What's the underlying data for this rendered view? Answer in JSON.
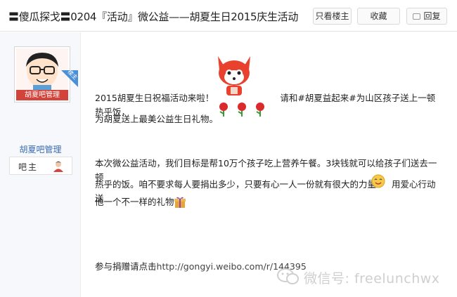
{
  "header": {
    "title": "〓傻瓜探戈〓0204『活动』微公益——胡夏生日2015庆生活动",
    "only_author_label": "只看楼主",
    "collect_label": "收藏",
    "reply_label": "回复"
  },
  "sidebar": {
    "corner_badge": "楼主",
    "avatar_caption": "胡夏吧管理",
    "username": "胡夏吧管理",
    "role": "吧主"
  },
  "post": {
    "line1_a": "2015胡夏生日祝福活动来啦！",
    "line1_b": "请和#胡夏益起来#为山区孩子送上一顿热乎饭，",
    "line2": "为胡夏送上最美公益生日礼物。",
    "para2_l1": "本次微公益活动，我们目标是帮10万个孩子吃上营养午餐。3块钱就可以给孩子们送去一顿",
    "para2_l2": "热乎的饭。咱不要求每人要捐出多少，只要有心一人一份就有很大的力量",
    "para2_l2b": "用爱心行动送",
    "para2_l3": "他一个不一样的礼物",
    "donate_prefix": "参与捐赠请点击",
    "donate_link": "http://gongyi.weibo.com/r/144395"
  },
  "watermark": {
    "text": "微信号: freelunchwx"
  },
  "colors": {
    "link_blue": "#3a6bb3",
    "badge_blue": "#4a90d9",
    "accent_red": "#d2433a",
    "watermark_gray": "#cfcfcf"
  }
}
